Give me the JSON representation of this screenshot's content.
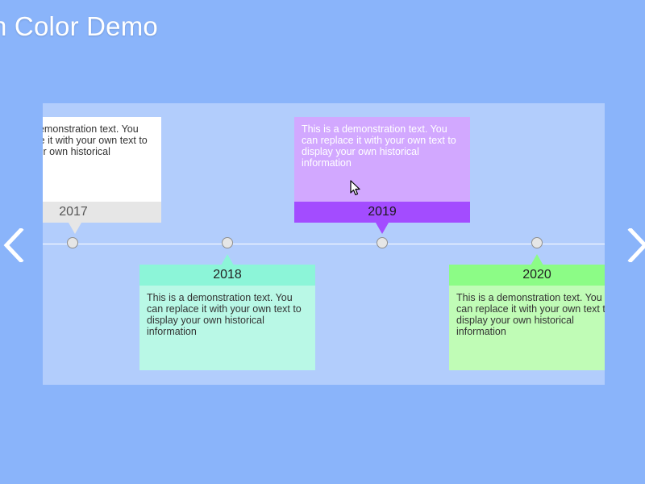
{
  "page": {
    "title": "n Color Demo"
  },
  "colors": {
    "background": "#8ab4fa",
    "frame": "#b2cdfc",
    "card_2017_header": "#e6e6e6",
    "card_2018_header": "#8cf5d8",
    "card_2019_header": "#a34cff",
    "card_2020_header": "#8cfc86"
  },
  "navigation": {
    "prev_icon": "chevron-left-icon",
    "next_icon": "chevron-right-icon"
  },
  "timeline": {
    "events": [
      {
        "year": "2017",
        "text": "This is a demonstration text. You can replace it with your own text to display your own historical information"
      },
      {
        "year": "2018",
        "text": "This is a demonstration text. You can replace it with your own text to display your own historical information"
      },
      {
        "year": "2019",
        "text": "This is a demonstration text. You can replace it with your own text to display your own historical information"
      },
      {
        "year": "2020",
        "text": "This is a demonstration text. You can replace it with your own text to display your own historical information"
      }
    ]
  }
}
